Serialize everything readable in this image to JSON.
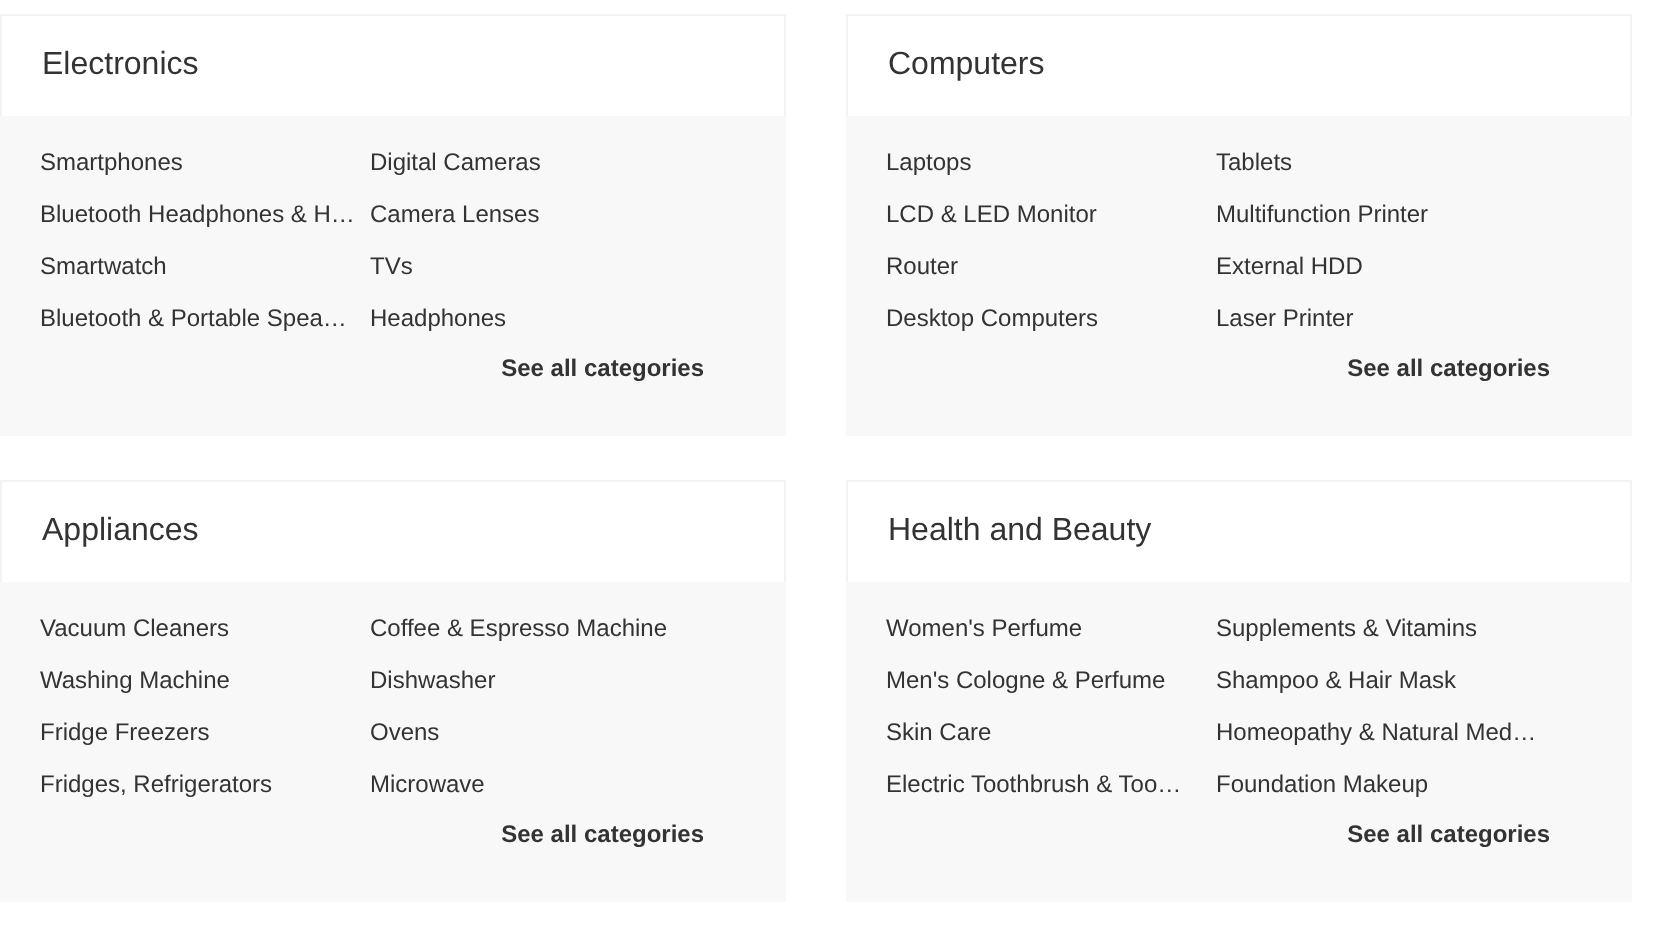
{
  "categories": [
    {
      "title": "Electronics",
      "items": [
        "Smartphones",
        "Digital Cameras",
        "Bluetooth Headphones & H…",
        "Camera Lenses",
        "Smartwatch",
        "TVs",
        "Bluetooth & Portable Spea…",
        "Headphones"
      ],
      "link": "See all categories"
    },
    {
      "title": "Computers",
      "items": [
        "Laptops",
        "Tablets",
        "LCD & LED Monitor",
        "Multifunction Printer",
        "Router",
        "External HDD",
        "Desktop Computers",
        "Laser Printer"
      ],
      "link": "See all categories"
    },
    {
      "title": "Appliances",
      "items": [
        "Vacuum Cleaners",
        "Coffee & Espresso Machine",
        "Washing Machine",
        "Dishwasher",
        "Fridge Freezers",
        "Ovens",
        "Fridges, Refrigerators",
        "Microwave"
      ],
      "link": "See all categories"
    },
    {
      "title": "Health and Beauty",
      "items": [
        "Women's Perfume",
        "Supplements & Vitamins",
        "Men's Cologne & Perfume",
        "Shampoo & Hair Mask",
        "Skin Care",
        "Homeopathy & Natural Med…",
        "Electric Toothbrush & Too…",
        "Foundation Makeup"
      ],
      "link": "See all categories"
    }
  ]
}
